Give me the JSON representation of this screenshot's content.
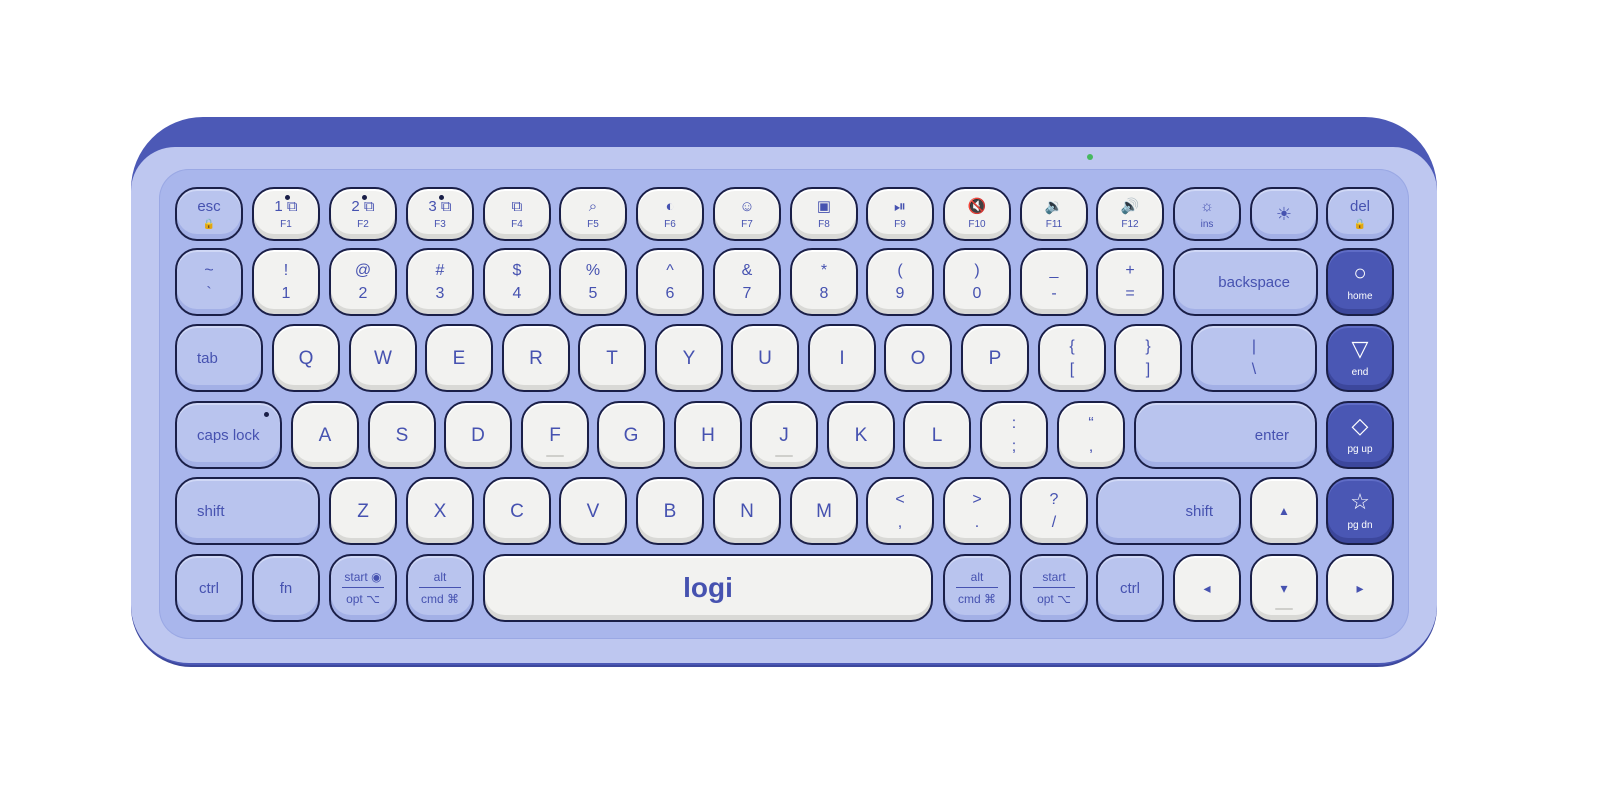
{
  "keyboard": {
    "brand": "logi",
    "colors": {
      "body": "#4c59b6",
      "deck": "#a9b6ec",
      "key_white": "#f2f2f0",
      "key_lilac": "#b9c4ee",
      "key_navy": "#4a57b4",
      "legend": "#4652b0"
    },
    "status_led": "green",
    "rows": {
      "function": [
        {
          "main": "esc",
          "sub": "🔒"
        },
        {
          "main": "1 ⧉",
          "sub": "F1"
        },
        {
          "main": "2 ⧉",
          "sub": "F2"
        },
        {
          "main": "3 ⧉",
          "sub": "F3"
        },
        {
          "main": "⧉",
          "sub": "F4",
          "icon": "screenshot-icon"
        },
        {
          "main": "⌕",
          "sub": "F5",
          "icon": "search-icon"
        },
        {
          "main": "◐",
          "sub": "F6",
          "icon": "dictation-icon"
        },
        {
          "main": "☺",
          "sub": "F7",
          "icon": "emoji-icon"
        },
        {
          "main": "▣",
          "sub": "F8",
          "icon": "snipping-icon"
        },
        {
          "main": "⏯",
          "sub": "F9",
          "icon": "play-pause-icon"
        },
        {
          "main": "🔇",
          "sub": "F10",
          "icon": "mute-icon"
        },
        {
          "main": "🔉",
          "sub": "F11",
          "icon": "volume-down-icon"
        },
        {
          "main": "🔊",
          "sub": "F12",
          "icon": "volume-up-icon"
        },
        {
          "main": "☼",
          "sub": "ins",
          "icon": "brightness-down-icon"
        },
        {
          "main": "☀",
          "sub": "",
          "icon": "brightness-up-icon"
        },
        {
          "main": "del",
          "sub": "🔒"
        }
      ],
      "number": [
        {
          "top": "~",
          "bottom": "`"
        },
        {
          "top": "!",
          "bottom": "1"
        },
        {
          "top": "@",
          "bottom": "2"
        },
        {
          "top": "#",
          "bottom": "3"
        },
        {
          "top": "$",
          "bottom": "4"
        },
        {
          "top": "%",
          "bottom": "5"
        },
        {
          "top": "^",
          "bottom": "6"
        },
        {
          "top": "&",
          "bottom": "7"
        },
        {
          "top": "*",
          "bottom": "8"
        },
        {
          "top": "(",
          "bottom": "9"
        },
        {
          "top": ")",
          "bottom": "0"
        },
        {
          "top": "_",
          "bottom": "-"
        },
        {
          "top": "+",
          "bottom": "="
        }
      ],
      "backspace": "backspace",
      "home": {
        "icon": "○",
        "label": "home"
      },
      "tab": "tab",
      "qwerty": [
        "Q",
        "W",
        "E",
        "R",
        "T",
        "Y",
        "U",
        "I",
        "O",
        "P"
      ],
      "bracket_left": {
        "top": "{",
        "bottom": "["
      },
      "bracket_right": {
        "top": "}",
        "bottom": "]"
      },
      "backslash": {
        "top": "|",
        "bottom": "\\"
      },
      "end": {
        "icon": "▽",
        "label": "end"
      },
      "caps": "caps lock",
      "home_row": [
        "A",
        "S",
        "D",
        "F",
        "G",
        "H",
        "J",
        "K",
        "L"
      ],
      "semicolon": {
        "top": ":",
        "bottom": ";"
      },
      "quote": {
        "top": "“",
        "bottom": "‚"
      },
      "enter": "enter",
      "pgup": {
        "icon": "◇",
        "label": "pg up"
      },
      "shift_left": "shift",
      "bottom_row": [
        "Z",
        "X",
        "C",
        "V",
        "B",
        "N",
        "M"
      ],
      "comma": {
        "top": "<",
        "bottom": ","
      },
      "period": {
        "top": ">",
        "bottom": "."
      },
      "slash": {
        "top": "?",
        "bottom": "/"
      },
      "shift_right": "shift",
      "arrow_up": "▲",
      "pgdn": {
        "icon": "☆",
        "label": "pg dn"
      },
      "ctrl_left": "ctrl",
      "fn": "fn",
      "start_left": {
        "top": "start ◉",
        "bottom": "opt ⌥"
      },
      "alt_left": {
        "top": "alt",
        "bottom": "cmd ⌘"
      },
      "alt_right": {
        "top": "alt",
        "bottom": "cmd ⌘"
      },
      "start_right": {
        "top": "start",
        "bottom": "opt ⌥"
      },
      "ctrl_right": "ctrl",
      "arrow_left": "◂",
      "arrow_down": "▾",
      "arrow_right": "▸"
    }
  }
}
